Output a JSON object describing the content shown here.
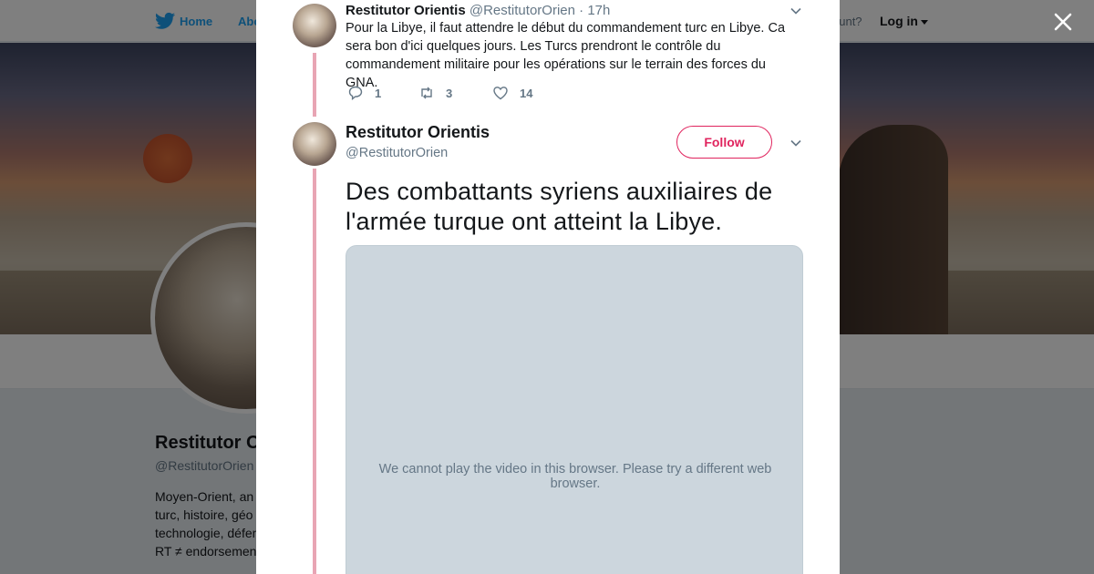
{
  "background_page": {
    "nav": {
      "home_label": "Home",
      "about_label": "Abo",
      "account_prompt": "ccount?",
      "login_label": "Log in"
    },
    "profile": {
      "name": "Restitutor O",
      "handle": "@RestitutorOrien",
      "bio_lines": [
        "Moyen-Orient, an",
        "turc, histoire, géo",
        "technologie, défen",
        "RT ≠ endorsemen"
      ]
    }
  },
  "modal": {
    "close_icon": "close-icon",
    "parent_tweet": {
      "name": "Restitutor Orientis",
      "handle": "@RestitutorOrien",
      "separator": "·",
      "time": "17h",
      "text": "Pour la Libye, il faut attendre le début du commandement turc en Libye. Ca sera bon d'ici quelques jours. Les Turcs prendront le contrôle du commandement militaire pour les opérations sur le terrain des forces du GNA.",
      "replies": "1",
      "retweets": "3",
      "likes": "14"
    },
    "main_tweet": {
      "name": "Restitutor Orientis",
      "handle": "@RestitutorOrien",
      "follow_label": "Follow",
      "text": "Des combattants syriens auxiliaires de l'armée turque ont atteint la Libye.",
      "video_message": "We cannot play the video in this browser. Please try a different web browser."
    }
  },
  "colors": {
    "twitter_blue": "#1da1f2",
    "follow_accent": "#e0245e",
    "thread_line": "#e8a5b4",
    "video_placeholder": "#ccd6dd"
  }
}
